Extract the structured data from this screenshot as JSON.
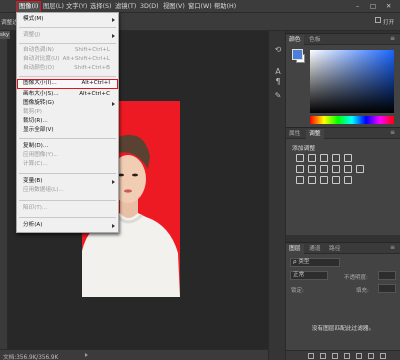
{
  "menubar": {
    "items": [
      {
        "label": "图像(I)",
        "active": true
      },
      {
        "label": "图层(L)"
      },
      {
        "label": "文字(Y)"
      },
      {
        "label": "选择(S)"
      },
      {
        "label": "滤镜(T)"
      },
      {
        "label": "3D(D)"
      },
      {
        "label": "视图(V)"
      },
      {
        "label": "窗口(W)"
      },
      {
        "label": "帮助(H)"
      }
    ],
    "window_controls": {
      "minimize": "–",
      "restore": "□",
      "close": "✕"
    }
  },
  "options_bar": {
    "left_text": "调整边",
    "right_text": "打开"
  },
  "document": {
    "tab_label": "sky",
    "status": "文档:356.9K/356.9K"
  },
  "image_menu": {
    "items": [
      {
        "label": "模式(M)",
        "submenu": true
      },
      {
        "label": "调整(J)",
        "submenu": true,
        "disabled": true
      },
      {
        "label": "自动色调(N)",
        "shortcut": "Shift+Ctrl+L",
        "disabled": true
      },
      {
        "label": "自动对比度(U)",
        "shortcut": "Alt+Shift+Ctrl+L",
        "disabled": true
      },
      {
        "label": "自动颜色(O)",
        "shortcut": "Shift+Ctrl+B",
        "disabled": true
      },
      {
        "label": "图像大小(I)...",
        "shortcut": "Alt+Ctrl+I",
        "highlighted": true
      },
      {
        "label": "画布大小(S)...",
        "shortcut": "Alt+Ctrl+C"
      },
      {
        "label": "图像旋转(G)",
        "submenu": true
      },
      {
        "label": "裁剪(P)",
        "disabled": true
      },
      {
        "label": "裁切(R)..."
      },
      {
        "label": "显示全部(V)"
      },
      {
        "label": "复制(D)..."
      },
      {
        "label": "应用图像(Y)...",
        "disabled": true
      },
      {
        "label": "计算(C)...",
        "disabled": true
      },
      {
        "label": "变量(B)",
        "submenu": true
      },
      {
        "label": "应用数据组(L)...",
        "disabled": true
      },
      {
        "label": "陷印(T)...",
        "disabled": true
      },
      {
        "label": "分析(A)",
        "submenu": true
      }
    ]
  },
  "panels": {
    "color": {
      "tabs": [
        "颜色",
        "色板"
      ],
      "fg_color": "#4a80d8",
      "bg_color": "#ffffff"
    },
    "adjustments": {
      "tabs": [
        "属性",
        "调整"
      ],
      "heading": "添加调整"
    },
    "layers": {
      "tabs": [
        "图层",
        "通道",
        "路径"
      ],
      "filter_label": "ρ 类型",
      "blend_mode": "正常",
      "opacity_label": "不透明度:",
      "lock_label": "锁定:",
      "fill_label": "填充:",
      "empty_message": "没有图层匹配此过滤器。"
    }
  },
  "colors": {
    "highlight_red": "#e0141e",
    "photo_background": "#ee1a23"
  }
}
